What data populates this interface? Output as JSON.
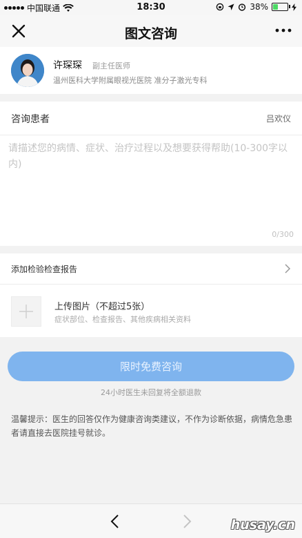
{
  "status_bar": {
    "carrier": "中国联通",
    "time": "18:30",
    "battery": "38%",
    "battery_level": 0.38
  },
  "nav": {
    "title": "图文咨询",
    "close_icon": "close-icon",
    "more_icon": "more-icon"
  },
  "doctor": {
    "name": "许琛琛",
    "title": "副主任医师",
    "hospital": "温州医科大学附属眼视光医院  准分子激光专科"
  },
  "patient": {
    "label": "咨询患者",
    "value": "吕欢仪"
  },
  "description": {
    "placeholder": "请描述您的病情、症状、治疗过程以及想要获得帮助(10-300字以内)",
    "value": "",
    "counter": "0/300"
  },
  "report": {
    "label": "添加检验检查报告"
  },
  "upload": {
    "title": "上传图片（不超过5张）",
    "hint": "症状部位、检查报告、其他疾病相关资料"
  },
  "consult": {
    "button_label": "限时免费咨询",
    "note": "24小时医生未回复将全额退款"
  },
  "tip": {
    "text": "温馨提示：医生的回答仅作为健康咨询类建议，不作为诊断依据，病情危急患者请直接去医院挂号就诊。"
  },
  "toolbar": {
    "back_icon": "chevron-left-icon",
    "forward_icon": "chevron-right-icon"
  },
  "watermark": "husay.cn",
  "colors": {
    "accent": "#7fb4ee",
    "background": "#f2f2f2"
  }
}
